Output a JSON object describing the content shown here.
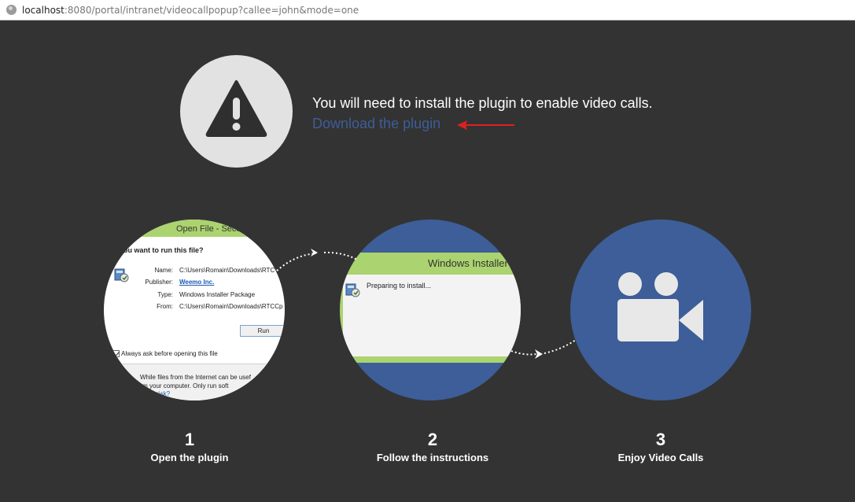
{
  "browser": {
    "url_host": "localhost",
    "url_rest": ":8080/portal/intranet/videocallpopup?callee=john&mode=one"
  },
  "notice": {
    "message": "You will need to install the plugin to enable video calls.",
    "download_link": "Download the plugin"
  },
  "step1_image": {
    "title": "Open File - Secu",
    "question": "you want to run this file?",
    "fields": [
      {
        "label": "Name:",
        "value": "C:\\Users\\Romain\\Downloads\\RTC"
      },
      {
        "label": "Publisher:",
        "value": "Weemo Inc."
      },
      {
        "label": "Type:",
        "value": "Windows Installer Package"
      },
      {
        "label": "From:",
        "value": "C:\\Users\\Romain\\Downloads\\RTCCp"
      }
    ],
    "run_button": "Run",
    "checkbox_label": "Always ask before opening this file",
    "warning_line1": "While files from the Internet can be usef",
    "warning_line2": "arm your computer. Only run soft",
    "warning_link": "he risk?"
  },
  "step2_image": {
    "title": "Windows Installer",
    "status": "Preparing to install..."
  },
  "steps": [
    {
      "number": "1",
      "label": "Open the plugin"
    },
    {
      "number": "2",
      "label": "Follow the instructions"
    },
    {
      "number": "3",
      "label": "Enjoy Video Calls"
    }
  ],
  "colors": {
    "background": "#333333",
    "accent_blue": "#3d5e98",
    "installer_green": "#abd36f",
    "arrow_red": "#e02020"
  },
  "icons": [
    "globe-icon",
    "warning-icon",
    "arrow-left-icon",
    "package-icon",
    "video-camera-icon",
    "dotted-arrow-icon"
  ]
}
